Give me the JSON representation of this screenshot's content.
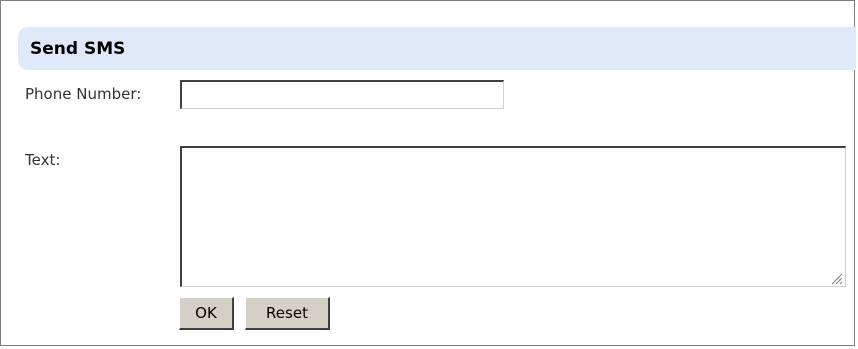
{
  "form": {
    "title": "Send SMS",
    "phone_label": "Phone Number:",
    "phone_value": "",
    "text_label": "Text:",
    "text_value": "",
    "ok_label": "OK",
    "reset_label": "Reset"
  },
  "colors": {
    "header_bg": "#dfe9fa",
    "border": "#7f7f7f",
    "button_face": "#d4d0c8"
  },
  "icons": {
    "resize_grip": "resize-grip-icon"
  }
}
